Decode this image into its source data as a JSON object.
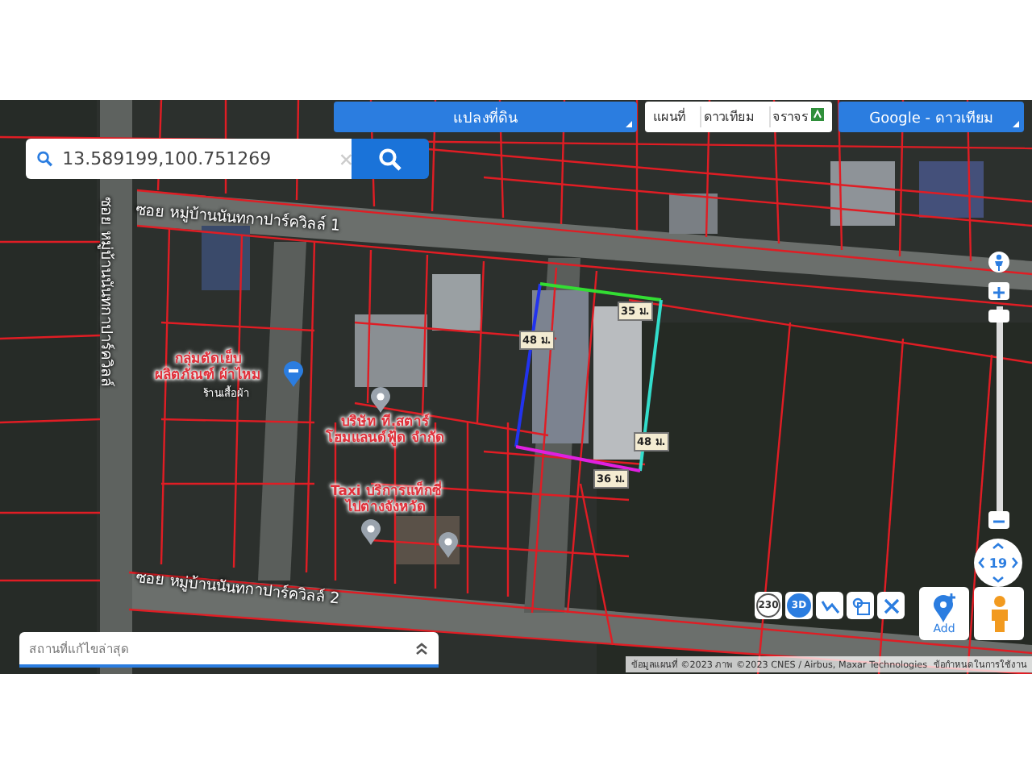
{
  "layer_dropdown": {
    "label": "แปลงที่ดิน"
  },
  "map_type_buttons": [
    {
      "label": "แผนที่"
    },
    {
      "label": "ดาวเทียม"
    },
    {
      "label": "จราจร"
    }
  ],
  "basemap_dropdown": {
    "label": "Google - ดาวเทียม"
  },
  "search": {
    "value": "13.589199,100.751269"
  },
  "road_labels": [
    {
      "text": "ซอย หมู่บ้านนันทกาปาร์ควิลล์ 1",
      "kind": "horizontal"
    },
    {
      "text": "ซอย หมู่บ้านนันทกาปาร์ควิลล์ 2",
      "kind": "horizontal"
    },
    {
      "text": "ซอย หมู่บ้านนันทกาปาร์ควิลล์",
      "kind": "vertical"
    }
  ],
  "places": [
    {
      "lines": [
        "กลุ่มตัดเย็บ",
        "ผลิตภัณฑ์ ผ้าไหม"
      ],
      "note": "ร้านเสื้อผ้า"
    },
    {
      "lines": [
        "บริษัท ที.สตาร์",
        "โฮมแลนด์ฟู้ด จำกัด"
      ]
    },
    {
      "lines": [
        "Taxi บริการแท็กซี่",
        "ไปต่างจังหวัด"
      ]
    }
  ],
  "measurements": [
    {
      "label": "48 ม."
    },
    {
      "label": "35 ม."
    },
    {
      "label": "48 ม."
    },
    {
      "label": "36 ม."
    }
  ],
  "tools": [
    {
      "kind": "text",
      "label": "230"
    },
    {
      "kind": "text",
      "label": "3D"
    },
    {
      "kind": "route"
    },
    {
      "kind": "zoombox"
    },
    {
      "kind": "close"
    }
  ],
  "add_button": {
    "label": "Add"
  },
  "zoom": {
    "level_text": "19"
  },
  "recent_panel": {
    "title": "สถานที่แก้ไขล่าสุด"
  },
  "attribution": {
    "text": "ข้อมูลแผนที่ ©2023 ภาพ ©2023 CNES / Airbus, Maxar Technologies",
    "terms": "ข้อกำหนดในการใช้งาน"
  }
}
